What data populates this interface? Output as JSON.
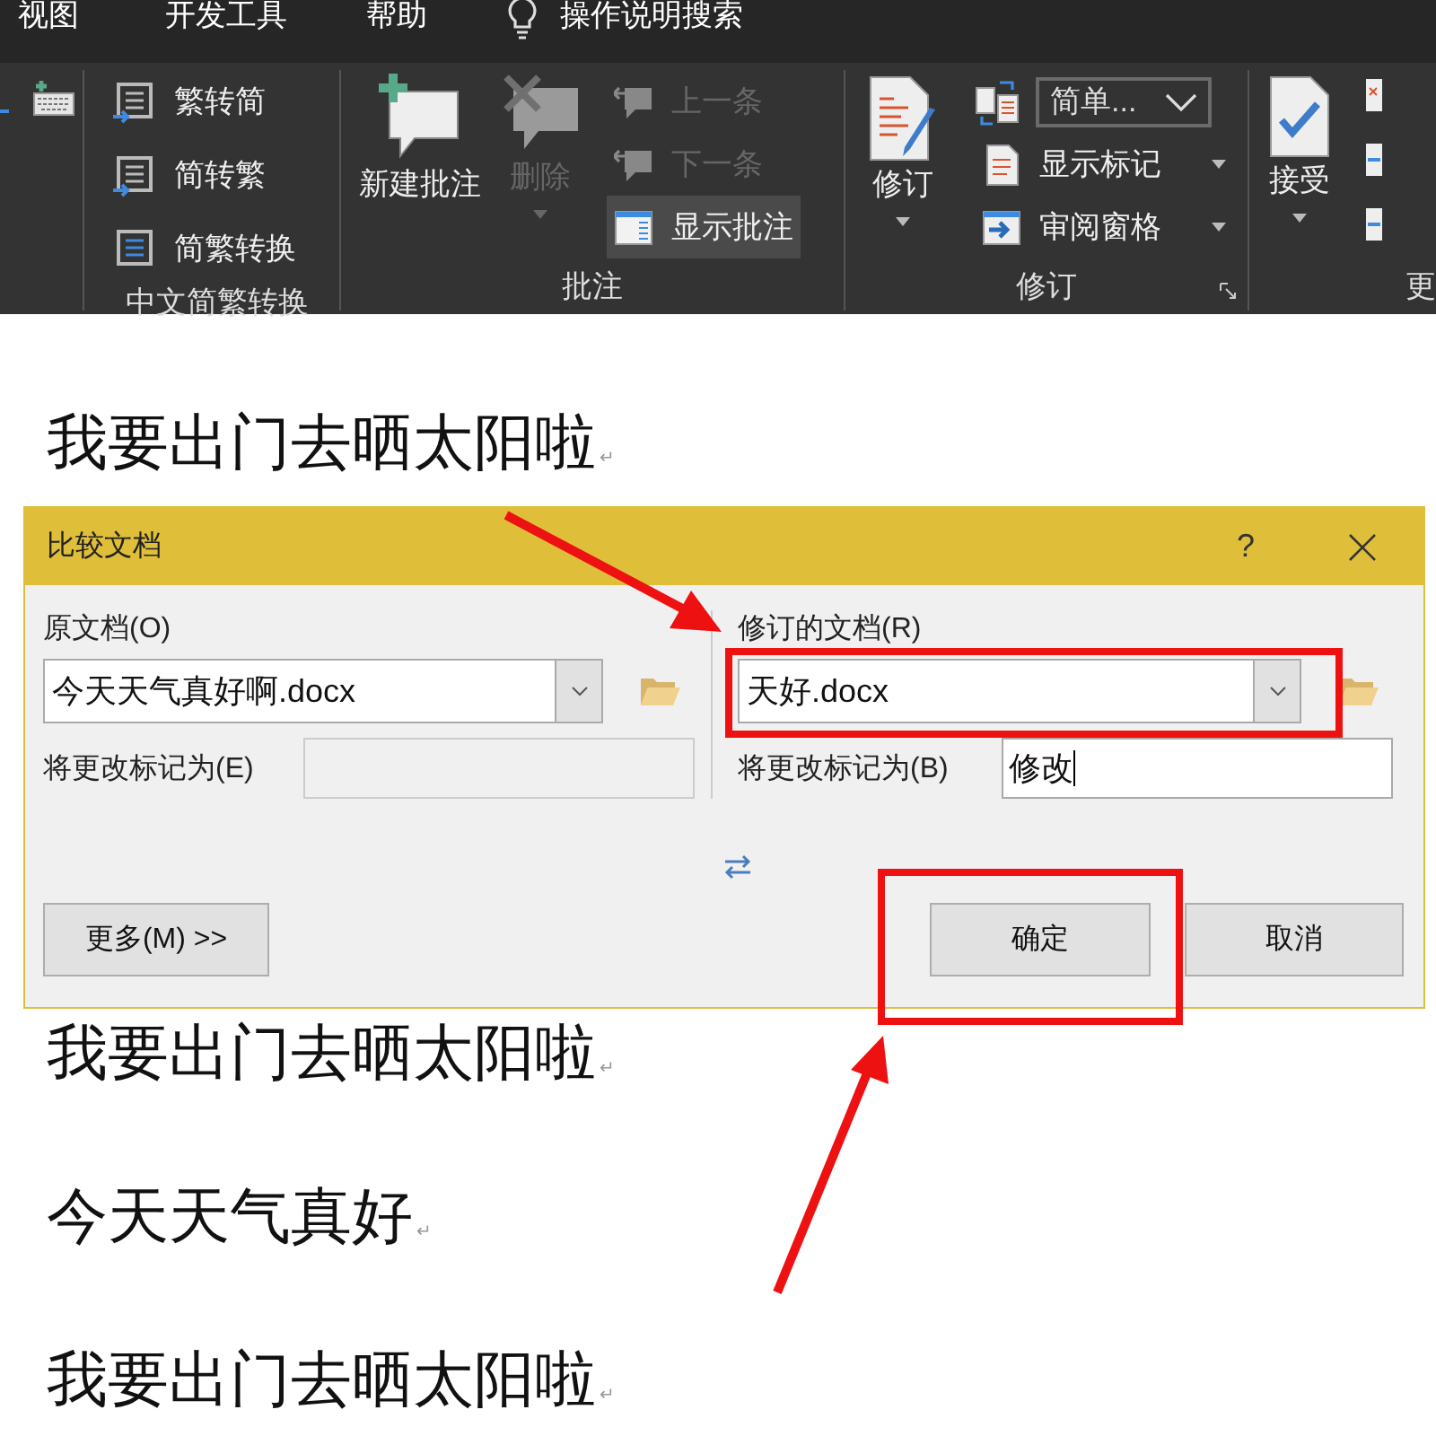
{
  "menu_bar": {
    "tabs": [
      {
        "label": "视图"
      },
      {
        "label": "开发工具"
      },
      {
        "label": "帮助"
      }
    ],
    "search": "操作说明搜索"
  },
  "ribbon": {
    "conversion": {
      "label": "中文简繁转换",
      "items": [
        {
          "label": "繁转简"
        },
        {
          "label": "简转繁"
        },
        {
          "label": "简繁转换"
        }
      ]
    },
    "comments": {
      "label": "批注",
      "items": [
        {
          "label": "新建批注",
          "disabled": false,
          "selected": false
        },
        {
          "label": "删除",
          "disabled": true,
          "selected": false
        },
        {
          "label": "上一条",
          "disabled": true,
          "selected": false
        },
        {
          "label": "下一条",
          "disabled": true,
          "selected": false
        },
        {
          "label": "显示批注",
          "disabled": false,
          "selected": true
        }
      ]
    },
    "tracking": {
      "label": "修订",
      "track_label": "修订",
      "markup_mode": "简单...",
      "items": [
        {
          "label": "显示标记"
        },
        {
          "label": "审阅窗格"
        }
      ]
    },
    "changes": {
      "label": "更",
      "accept_label": "接受"
    }
  },
  "document": {
    "paragraphs": [
      {
        "text": "我要出门去晒太阳啦",
        "mark": "↵"
      },
      {
        "text": "我要出门去晒太阳啦",
        "mark": "↵"
      },
      {
        "text": "今天天气真好",
        "mark": "↵"
      },
      {
        "text": "我要出门去晒太阳啦",
        "mark": "↵"
      }
    ]
  },
  "dialog": {
    "title": "比较文档",
    "help": "?",
    "sides": [
      {
        "label": "原文档(O)",
        "value": "今天天气真好啊.docx",
        "mark_label": "将更改标记为(E)",
        "mark_disabled": true
      },
      {
        "label": "修订的文档(R)",
        "value": "天好.docx",
        "mark_label": "将更改标记为(B)",
        "mark_value": "修改",
        "mark_disabled": false
      }
    ],
    "buttons": [
      {
        "label": "更多(M) >>"
      },
      {
        "label": "确定"
      },
      {
        "label": "取消"
      }
    ]
  }
}
